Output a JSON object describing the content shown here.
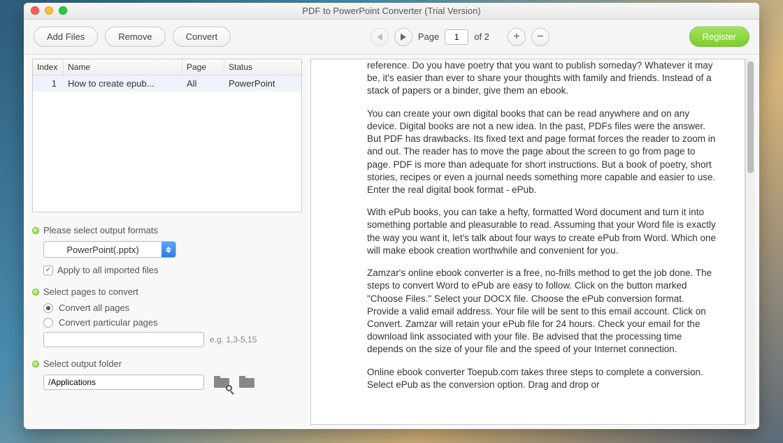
{
  "window": {
    "title": "PDF to PowerPoint Converter (Trial Version)"
  },
  "toolbar": {
    "add_files": "Add Files",
    "remove": "Remove",
    "convert": "Convert",
    "page_label": "Page",
    "page_value": "1",
    "page_total": "of 2",
    "register": "Register"
  },
  "table": {
    "headers": {
      "index": "Index",
      "name": "Name",
      "page": "Page",
      "status": "Status"
    },
    "rows": [
      {
        "index": "1",
        "name": "How to create epub...",
        "page": "All",
        "status": "PowerPoint"
      }
    ]
  },
  "settings": {
    "output_label": "Please select output formats",
    "output_format": "PowerPoint(.pptx)",
    "apply_all": "Apply to all imported files",
    "pages_label": "Select pages to convert",
    "convert_all": "Convert all pages",
    "convert_particular": "Convert particular pages",
    "range_hint": "e.g. 1,3-5,15",
    "folder_label": "Select output folder",
    "folder_path": "/Applications"
  },
  "preview": {
    "paragraphs": [
      "reference. Do you have poetry that you want to publish someday? Whatever it may be, it's easier than ever to share your thoughts with family and friends. Instead of a stack of papers or a binder, give them an ebook.",
      "You can create your own digital books that can be read anywhere and on any device. Digital books are not a new idea. In the past, PDFs files were the answer. But PDF has drawbacks. Its fixed text and page format forces the reader to zoom in and out. The reader has to move the page about the screen to go from page to page. PDF is more than adequate for short instructions. But a book of poetry, short stories, recipes or even a journal needs something more capable and easier to use. Enter the real digital book format - ePub.",
      "With ePub books, you can take a hefty, formatted Word document and turn it into something portable and pleasurable to read. Assuming that your Word file is exactly the way you want it, let's talk about four ways to create ePub from Word. Which one will make ebook creation worthwhile and convenient for you.",
      "Zamzar's online ebook converter is a free, no-frills method to get the job done. The steps to convert Word to ePub are easy to follow. Click on the button marked \"Choose Files.\" Select your DOCX file. Choose the ePub conversion format. Provide a valid email address. Your file will be sent to this email account. Click on Convert. Zamzar will retain your ePub file for 24 hours. Check your email for the download link associated with your file. Be advised that the processing time depends on the size of your file and the speed of your Internet connection.",
      "Online ebook converter Toepub.com takes three steps to complete a conversion. Select ePub as the conversion option. Drag and drop or"
    ]
  }
}
